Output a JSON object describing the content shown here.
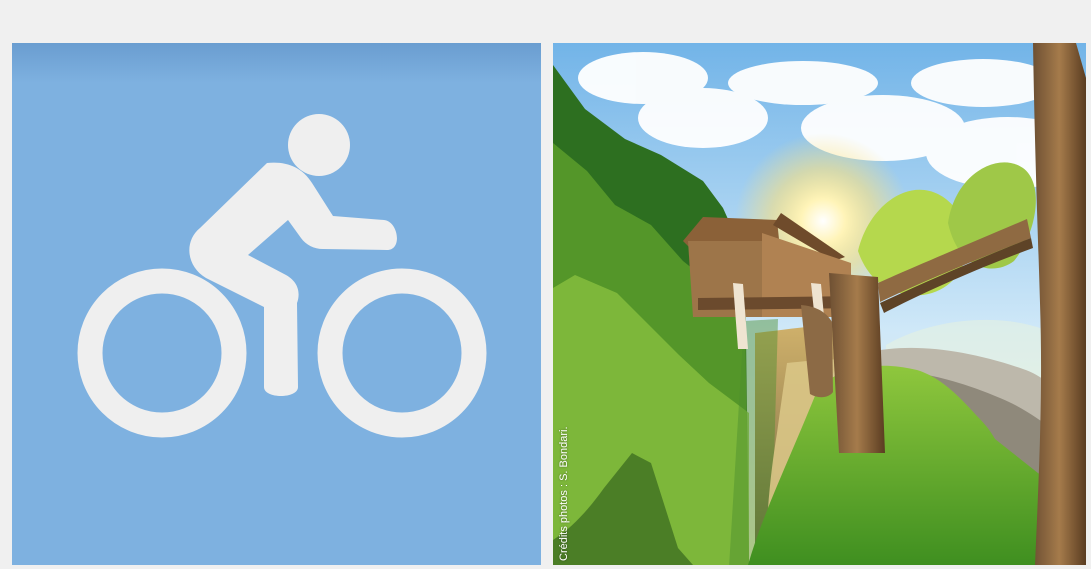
{
  "icon_panel": {
    "icon": "cyclist-icon",
    "background_color": "#7eb1e0",
    "icon_color": "#efefef"
  },
  "photo_panel": {
    "subject": "rural-stream-with-wooden-mill-photo",
    "credit": "Crédits photos : S. Bondari."
  },
  "colors": {
    "page_background": "#f0f0f0"
  }
}
